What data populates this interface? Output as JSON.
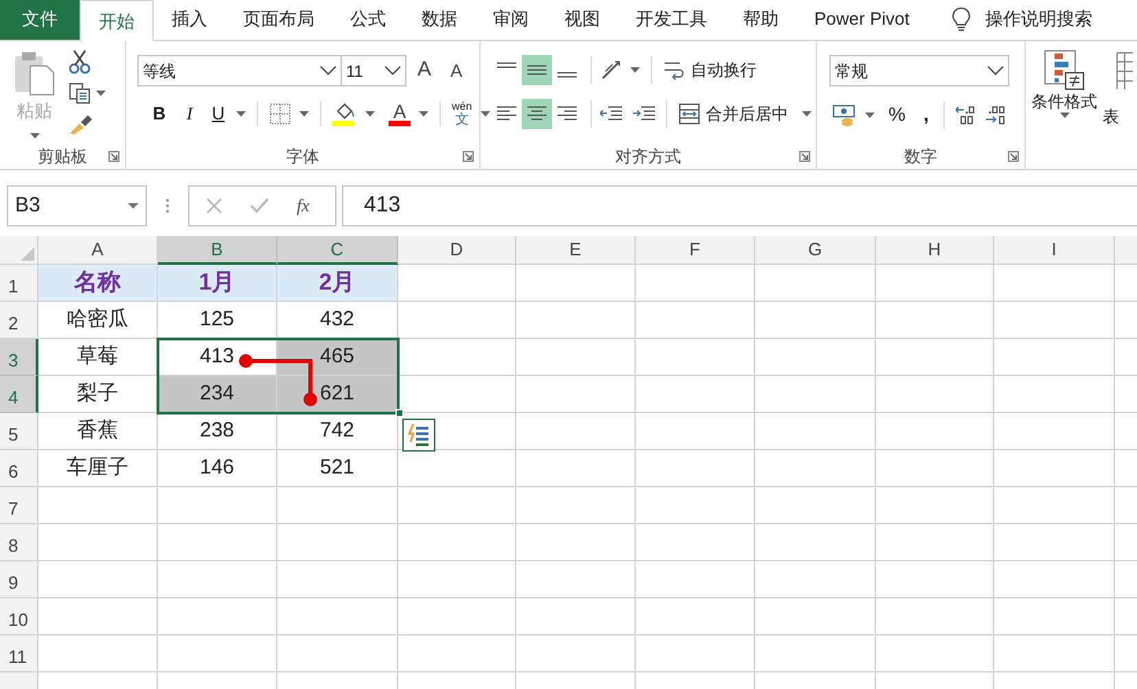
{
  "tabs": [
    {
      "label": "文件",
      "kind": "file",
      "selected": false
    },
    {
      "label": "开始",
      "kind": "tab",
      "selected": true
    },
    {
      "label": "插入",
      "kind": "tab",
      "selected": false
    },
    {
      "label": "页面布局",
      "kind": "tab",
      "selected": false
    },
    {
      "label": "公式",
      "kind": "tab",
      "selected": false
    },
    {
      "label": "数据",
      "kind": "tab",
      "selected": false
    },
    {
      "label": "审阅",
      "kind": "tab",
      "selected": false
    },
    {
      "label": "视图",
      "kind": "tab",
      "selected": false
    },
    {
      "label": "开发工具",
      "kind": "tab",
      "selected": false
    },
    {
      "label": "帮助",
      "kind": "tab",
      "selected": false
    },
    {
      "label": "Power Pivot",
      "kind": "tab",
      "selected": false
    }
  ],
  "search": {
    "label": "操作说明搜索"
  },
  "ribbon": {
    "clipboard": {
      "title": "剪贴板",
      "paste": "粘贴",
      "paste_disabled": true
    },
    "font": {
      "title": "字体",
      "font_name": "等线",
      "font_size": "11",
      "grow": "A",
      "shrink": "A",
      "bold": "B",
      "italic": "I",
      "underline": "U",
      "font_color": "A",
      "phonetic_top": "wén",
      "phonetic_bottom": "文"
    },
    "alignment": {
      "title": "对齐方式",
      "wrap_text": "自动换行",
      "merge_center": "合并后居中",
      "vertical_align": [
        {
          "selected": false
        },
        {
          "selected": true
        },
        {
          "selected": false
        }
      ],
      "horizontal_align": [
        {
          "selected": false
        },
        {
          "selected": true
        },
        {
          "selected": false
        }
      ]
    },
    "number": {
      "title": "数字",
      "format": "常规",
      "percent": "%",
      "comma": ","
    },
    "styles": {
      "conditional_format": "条件格式",
      "table_format": "表"
    }
  },
  "formula_bar": {
    "name_box": "B3",
    "fx": "fx",
    "formula": "413"
  },
  "sheet": {
    "columns": [
      {
        "label": "A",
        "selected": false
      },
      {
        "label": "B",
        "selected": true
      },
      {
        "label": "C",
        "selected": true
      },
      {
        "label": "D",
        "selected": false
      },
      {
        "label": "E",
        "selected": false
      },
      {
        "label": "F",
        "selected": false
      },
      {
        "label": "G",
        "selected": false
      },
      {
        "label": "H",
        "selected": false
      },
      {
        "label": "I",
        "selected": false
      }
    ],
    "rows": [
      {
        "label": "1",
        "kind": "header",
        "selected": false,
        "cells": [
          {
            "text": "名称",
            "selected": false
          },
          {
            "text": "1月",
            "selected": false
          },
          {
            "text": "2月",
            "selected": false
          }
        ]
      },
      {
        "label": "2",
        "kind": "data",
        "selected": false,
        "cells": [
          {
            "text": "哈密瓜",
            "selected": false
          },
          {
            "text": "125",
            "selected": false
          },
          {
            "text": "432",
            "selected": false
          }
        ]
      },
      {
        "label": "3",
        "kind": "data",
        "selected": true,
        "cells": [
          {
            "text": "草莓",
            "selected": false
          },
          {
            "text": "413",
            "selected": true
          },
          {
            "text": "465",
            "selected": true
          }
        ]
      },
      {
        "label": "4",
        "kind": "data",
        "selected": true,
        "cells": [
          {
            "text": "梨子",
            "selected": false
          },
          {
            "text": "234",
            "selected": true
          },
          {
            "text": "621",
            "selected": true
          }
        ]
      },
      {
        "label": "5",
        "kind": "data",
        "selected": false,
        "cells": [
          {
            "text": "香蕉",
            "selected": false
          },
          {
            "text": "238",
            "selected": false
          },
          {
            "text": "742",
            "selected": false
          }
        ]
      },
      {
        "label": "6",
        "kind": "data",
        "selected": false,
        "cells": [
          {
            "text": "车厘子",
            "selected": false
          },
          {
            "text": "146",
            "selected": false
          },
          {
            "text": "521",
            "selected": false
          }
        ]
      },
      {
        "label": "7",
        "selected": false
      },
      {
        "label": "8",
        "selected": false
      },
      {
        "label": "9",
        "selected": false
      },
      {
        "label": "10",
        "selected": false
      },
      {
        "label": "11",
        "selected": false
      }
    ]
  }
}
